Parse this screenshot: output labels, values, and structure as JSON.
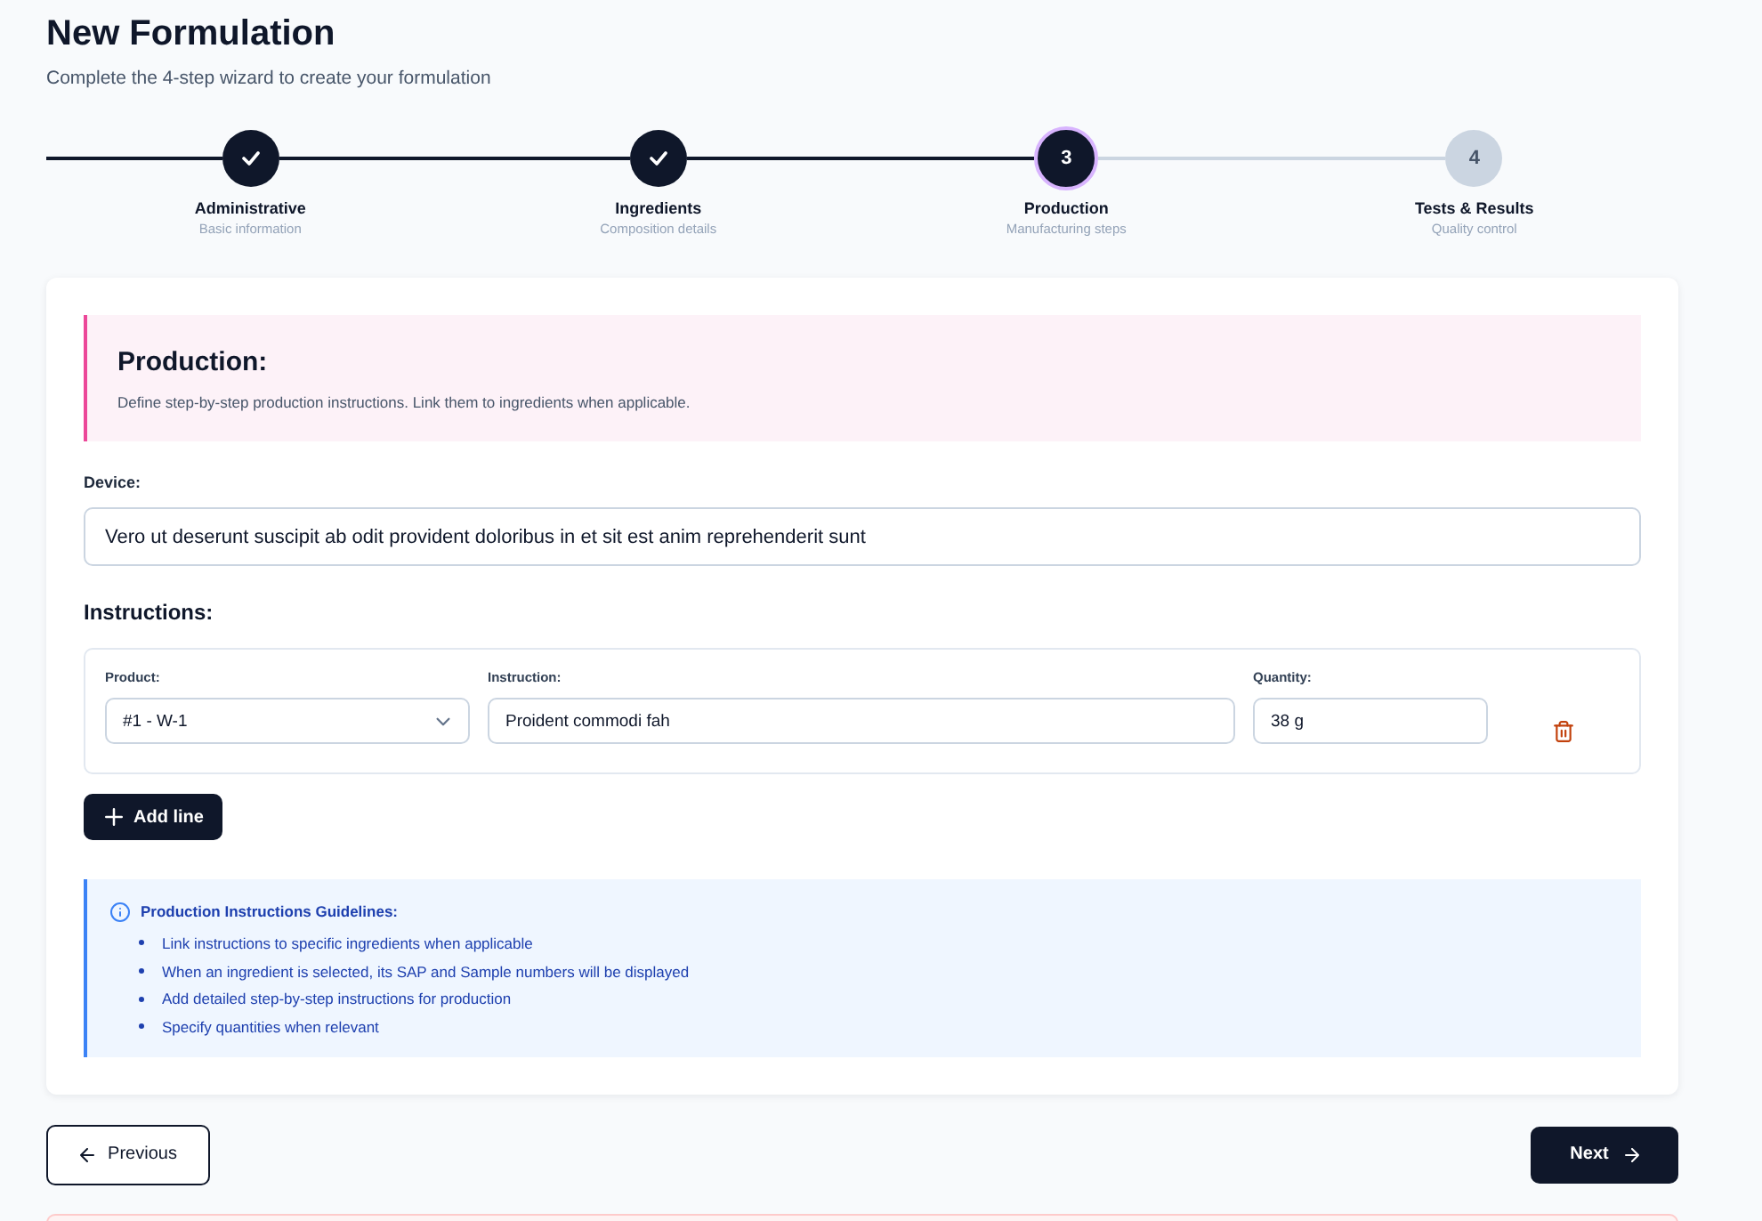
{
  "header": {
    "title": "New Formulation",
    "subtitle": "Complete the 4-step wizard to create your formulation"
  },
  "steps": [
    {
      "title": "Administrative",
      "subtitle": "Basic information",
      "completed": true,
      "selected": false
    },
    {
      "title": "Ingredients",
      "subtitle": "Composition details",
      "completed": true,
      "selected": false
    },
    {
      "number": "3",
      "title": "Production",
      "subtitle": "Manufacturing steps",
      "completed": false,
      "selected": true
    },
    {
      "number": "4",
      "title": "Tests & Results",
      "subtitle": "Quality control",
      "completed": false,
      "selected": false
    }
  ],
  "section": {
    "title": "Production:",
    "description": "Define step-by-step production instructions. Link them to ingredients when applicable."
  },
  "device": {
    "label": "Device:",
    "value": "Vero ut deserunt suscipit ab odit provident doloribus in et sit est anim reprehenderit sunt"
  },
  "instructions": {
    "title": "Instructions:",
    "rows": [
      {
        "product": {
          "label": "Product:",
          "value": "#1 - W-1"
        },
        "instruction": {
          "label": "Instruction:",
          "value": "Proident commodi fah"
        },
        "quantity": {
          "label": "Quantity:",
          "value": "38 g"
        }
      }
    ],
    "add_button": "Add line"
  },
  "guidelines": {
    "title": "Production Instructions Guidelines:",
    "items": [
      "Link instructions to specific ingredients when applicable",
      "When an ingredient is selected, its SAP and Sample numbers will be displayed",
      "Add detailed step-by-step instructions for production",
      "Specify quantities when relevant"
    ]
  },
  "navigation": {
    "previous": "Previous",
    "next": "Next"
  }
}
